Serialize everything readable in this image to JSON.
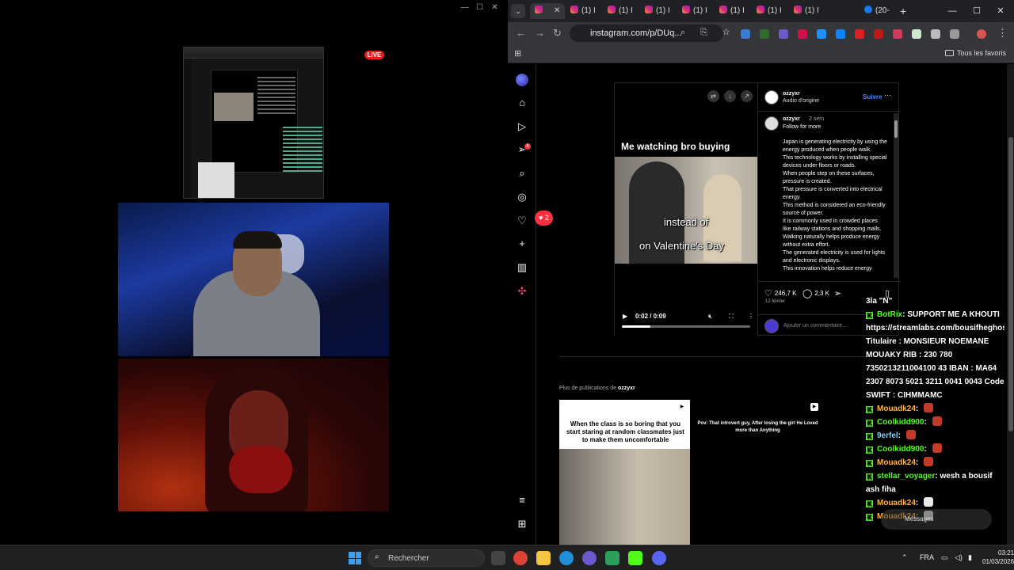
{
  "stream": {
    "live_label": "LIVE",
    "window_controls": [
      "—",
      "☐",
      "✕"
    ]
  },
  "browser": {
    "tabs": [
      "(1) I",
      "(1) I",
      "(1) I",
      "(1) I",
      "(1) I",
      "(1) I",
      "(1) I",
      "(20-"
    ],
    "active_tab_close": "✕",
    "new_tab": "+",
    "window_controls": [
      "—",
      "☐",
      "✕"
    ],
    "url": "instagram.com/p/DUq...",
    "bookmarks_folder": "Tous les favoris"
  },
  "instagram": {
    "likes_notification": "2",
    "notification_count": "4",
    "post": {
      "username": "ozzyxr",
      "audio": "Audio d'origine",
      "follow": "Suivre",
      "video_title": "Me watching bro buying",
      "caption_overlay_1": "instead of",
      "caption_overlay_2": "on Valentine's Day",
      "video_time": "0:02 / 0:09",
      "progress": 0.22,
      "caption_age": "2 sem",
      "caption_first": "Follow for more",
      "caption_lines": [
        "Japan is generating electricity by using the energy produced when people walk.",
        "This technology works by installing special devices under floors or roads.",
        "When people step on these surfaces, pressure is created.",
        "That pressure is converted into electrical energy.",
        "This method is considered an eco-friendly source of power.",
        "It is commonly used in crowded places like railway stations and shopping malls.",
        "Walking naturally helps produce energy without extra effort.",
        "The generated electricity is used for lights and electronic displays.",
        "This innovation helps reduce energy"
      ],
      "likes": "246,7 K",
      "comments": "2,3 K",
      "date": "12 février",
      "comment_placeholder": "Ajouter un commentaire..."
    },
    "more_posts_label": "Plus de publications de",
    "more_posts_user": "ozzyxr",
    "thumb_a_text": "When the class is so boring that you start staring at random classmates just to make them uncomfortable",
    "thumb_b_text": "Pov: That introvert guy, After losing the girl He Loved more than Anything",
    "messages_label": "Messages"
  },
  "chat": [
    {
      "user": "",
      "text": "3la \"N\"",
      "badge": false,
      "emote": false
    },
    {
      "user": "BotRix",
      "text": "SUPPORT ME A KHOUTI https://streamlabs.com/bousifheghost/tip Titulaire : MONSIEUR NOEMANE MOUAKY RIB : 230 780 7350213211004100 43 IBAN : MA64 2307 8073 5021 3211 0041 0043 Code SWIFT : CIHMMAMC",
      "badge": true,
      "emote": false
    },
    {
      "user": "Mouadk24",
      "text": "",
      "badge": true,
      "emote": true
    },
    {
      "user": "Coolkidd900",
      "text": "",
      "badge": true,
      "emote": true
    },
    {
      "user": "9erfel",
      "text": "",
      "badge": true,
      "emote": true
    },
    {
      "user": "Coolkidd900",
      "text": "",
      "badge": true,
      "emote": true
    },
    {
      "user": "Mouadk24",
      "text": "",
      "badge": true,
      "emote": true
    },
    {
      "user": "stellar_voyager",
      "text": "wesh a bousif ash fiha",
      "badge": true,
      "emote": false
    },
    {
      "user": "Mouadk24",
      "text": "",
      "badge": true,
      "emote": true
    },
    {
      "user": "Mouadk24",
      "text": "",
      "badge": true,
      "emote": true
    }
  ],
  "taskbar": {
    "search_placeholder": "Rechercher",
    "language": "FRA",
    "time": "03:21",
    "date": "01/03/2026"
  }
}
